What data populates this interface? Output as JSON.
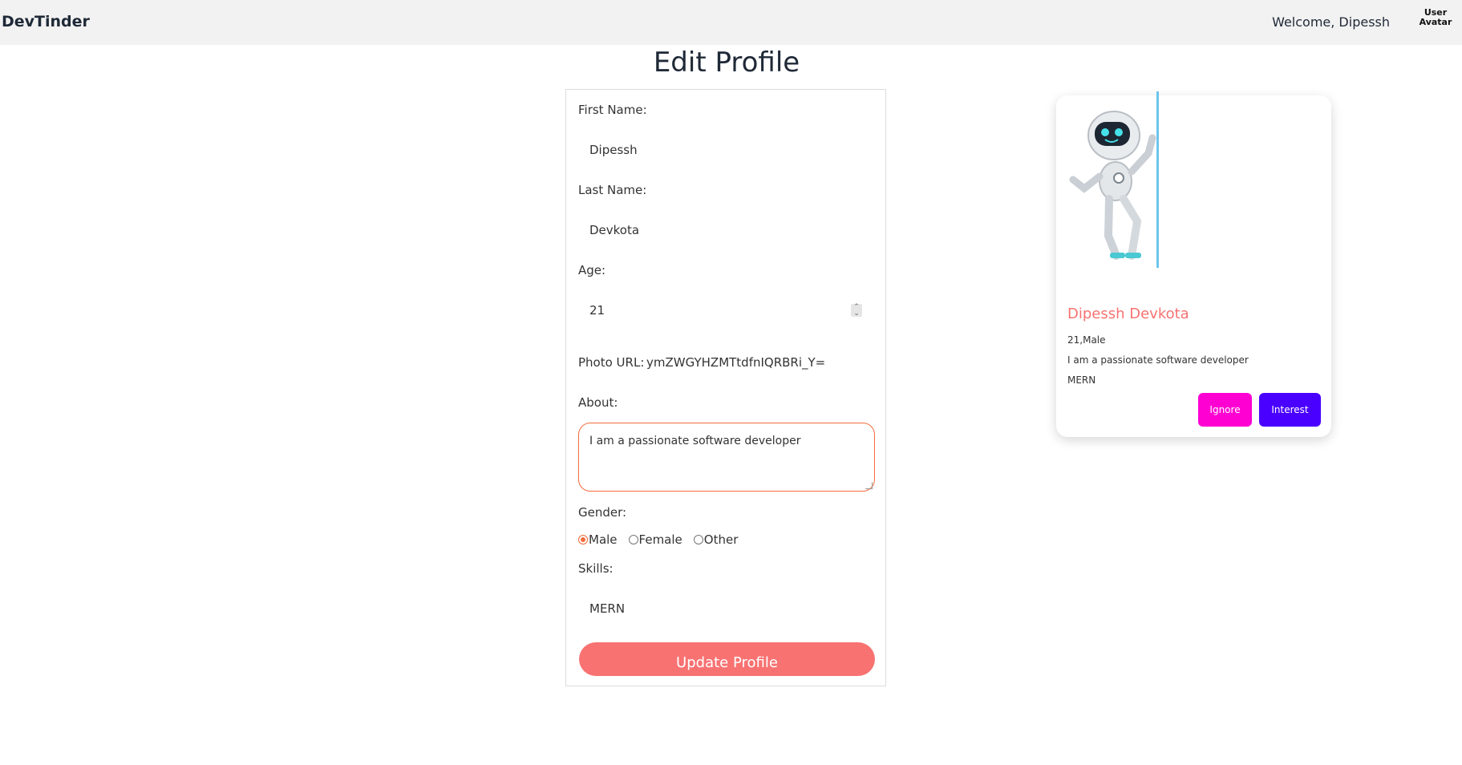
{
  "navbar": {
    "brand": "DevTinder",
    "welcome": "Welcome, Dipessh",
    "avatar_alt": "User Avatar"
  },
  "page": {
    "title": "Edit Profile"
  },
  "form": {
    "first_name_label": "First Name:",
    "first_name_value": "Dipessh",
    "last_name_label": "Last Name:",
    "last_name_value": "Devkota",
    "age_label": "Age:",
    "age_value": "21",
    "photo_label": "Photo URL:",
    "photo_value": "ymZWGYHZMTtdfnIQRBRi_Y=",
    "about_label": "About:",
    "about_value": "I am a passionate software developer",
    "gender_label": "Gender:",
    "gender_options": [
      "Male",
      "Female",
      "Other"
    ],
    "gender_selected": "Male",
    "skills_label": "Skills:",
    "skills_value": "MERN",
    "submit_label": "Update Profile"
  },
  "card": {
    "name": "Dipessh Devkota",
    "age_gender": "21,Male",
    "about": "I am a passionate software developer",
    "skills": "MERN",
    "ignore_label": "Ignore",
    "interest_label": "Interest"
  },
  "colors": {
    "primary": "#f87272",
    "accent_orange": "#f26c3b",
    "ignore": "#ff00d3",
    "interest": "#4a00ff",
    "navbar": "#f2f2f2"
  }
}
